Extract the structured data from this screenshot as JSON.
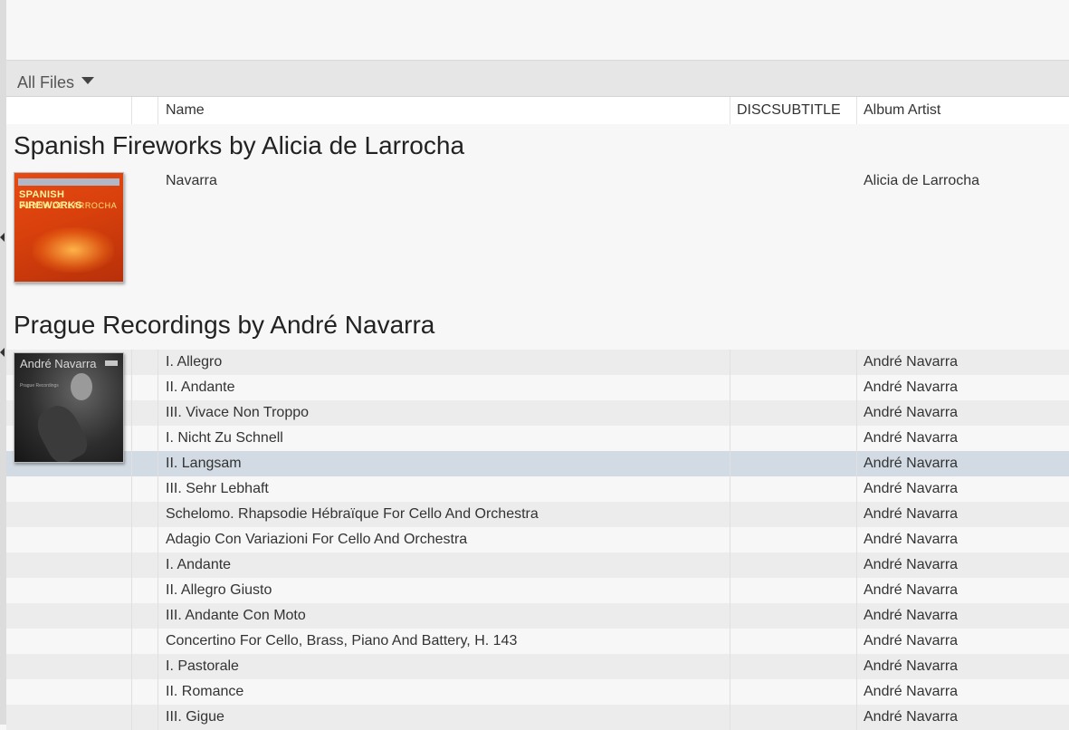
{
  "toolbar": {
    "filter_label": "All Files"
  },
  "columns": {
    "name": "Name",
    "discsubtitle": "DISCSUBTITLE",
    "album_artist": "Album Artist"
  },
  "groups": [
    {
      "title": "Spanish Fireworks by Alicia de Larrocha",
      "artwork": {
        "line1": "SPANISH FIREWORKS",
        "line2": "ALICIA DE LARROCHA"
      },
      "tracks": [
        {
          "name": "Navarra",
          "discsubtitle": "",
          "album_artist": "Alicia de Larrocha"
        }
      ]
    },
    {
      "title": "Prague Recordings by André Navarra",
      "artwork": {
        "line1": "André Navarra",
        "line2": "Prague Recordings"
      },
      "tracks": [
        {
          "name": "I. Allegro",
          "discsubtitle": "",
          "album_artist": "André Navarra"
        },
        {
          "name": "II. Andante",
          "discsubtitle": "",
          "album_artist": "André Navarra"
        },
        {
          "name": "III. Vivace Non Troppo",
          "discsubtitle": "",
          "album_artist": "André Navarra"
        },
        {
          "name": "I. Nicht Zu Schnell",
          "discsubtitle": "",
          "album_artist": "André Navarra"
        },
        {
          "name": "II. Langsam",
          "discsubtitle": "",
          "album_artist": "André Navarra",
          "selected": true
        },
        {
          "name": "III. Sehr Lebhaft",
          "discsubtitle": "",
          "album_artist": "André Navarra"
        },
        {
          "name": "Schelomo. Rhapsodie Hébraïque For Cello And Orchestra",
          "discsubtitle": "",
          "album_artist": "André Navarra"
        },
        {
          "name": "Adagio Con Variazioni For Cello And Orchestra",
          "discsubtitle": "",
          "album_artist": "André Navarra"
        },
        {
          "name": "I. Andante",
          "discsubtitle": "",
          "album_artist": "André Navarra"
        },
        {
          "name": "II. Allegro Giusto",
          "discsubtitle": "",
          "album_artist": "André Navarra"
        },
        {
          "name": "III. Andante Con Moto",
          "discsubtitle": "",
          "album_artist": "André Navarra"
        },
        {
          "name": "Concertino For Cello, Brass, Piano And Battery, H. 143",
          "discsubtitle": "",
          "album_artist": "André Navarra"
        },
        {
          "name": "I. Pastorale",
          "discsubtitle": "",
          "album_artist": "André Navarra"
        },
        {
          "name": "II. Romance",
          "discsubtitle": "",
          "album_artist": "André Navarra"
        },
        {
          "name": "III. Gigue",
          "discsubtitle": "",
          "album_artist": "André Navarra"
        }
      ]
    }
  ],
  "colors": {
    "selected_row": "#d2dbe3",
    "alt_row": "#ececec",
    "background": "#f7f7f7"
  }
}
